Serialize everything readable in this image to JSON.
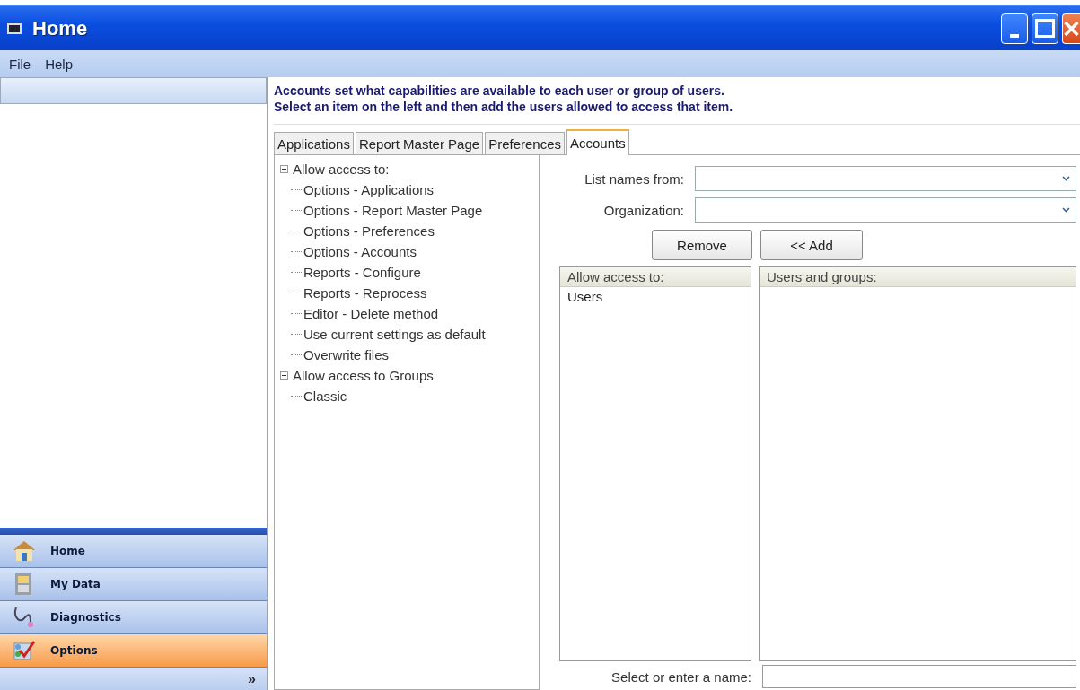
{
  "window": {
    "title": "Home"
  },
  "menu": [
    "File",
    "Help"
  ],
  "sidebar": {
    "items": [
      {
        "label": "Home",
        "selected": false
      },
      {
        "label": "My Data",
        "selected": false
      },
      {
        "label": "Diagnostics",
        "selected": false
      },
      {
        "label": "Options",
        "selected": true
      }
    ],
    "more": "»"
  },
  "description": [
    "Accounts set what capabilities are available to each user or group of users.",
    "Select an item on the left and then add the users allowed to access that item."
  ],
  "tabs": [
    {
      "label": "Applications",
      "selected": false
    },
    {
      "label": "Report Master Page",
      "selected": false
    },
    {
      "label": "Preferences",
      "selected": false
    },
    {
      "label": "Accounts",
      "selected": true
    }
  ],
  "tree": [
    {
      "label": "Allow access to:",
      "expanded": true,
      "children": [
        {
          "label": "Options - Applications"
        },
        {
          "label": "Options - Report Master Page"
        },
        {
          "label": "Options - Preferences"
        },
        {
          "label": "Options - Accounts"
        },
        {
          "label": "Reports - Configure"
        },
        {
          "label": "Reports - Reprocess"
        },
        {
          "label": "Editor - Delete method"
        },
        {
          "label": "Use current settings as default"
        },
        {
          "label": "Overwrite files"
        }
      ]
    },
    {
      "label": "Allow access to Groups",
      "expanded": true,
      "children": [
        {
          "label": "Classic"
        }
      ]
    }
  ],
  "fields": [
    {
      "label": "List names from:"
    },
    {
      "label": "Organization:"
    }
  ],
  "buttons": [
    "Remove",
    "<< Add"
  ],
  "lists": [
    {
      "header": "Allow access to:",
      "items": [
        "Users"
      ]
    },
    {
      "header": "Users and groups:"
    }
  ],
  "name_field": {
    "label": "Select or enter a name:"
  }
}
